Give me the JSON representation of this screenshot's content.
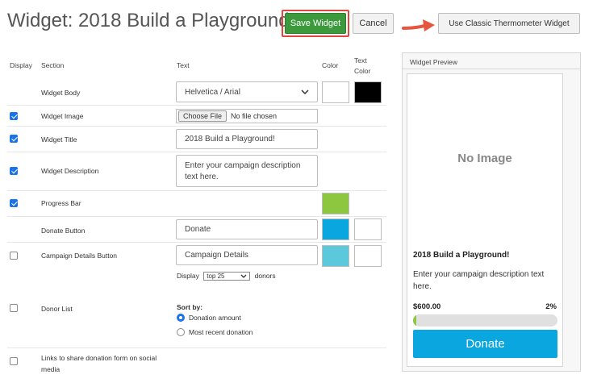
{
  "header": {
    "title": "Widget: 2018 Build a Playground!",
    "save_label": "Save Widget",
    "cancel_label": "Cancel",
    "classic_label": "Use Classic Thermometer Widget"
  },
  "columns": {
    "display": "Display",
    "section": "Section",
    "text": "Text",
    "color": "Color",
    "text_color_1": "Text",
    "text_color_2": "Color"
  },
  "rows": {
    "body": {
      "label": "Widget Body",
      "font_value": "Helvetica / Arial",
      "color": "#ffffff",
      "text_color": "#000000"
    },
    "image": {
      "label": "Widget Image",
      "checked": true,
      "file_button": "Choose File",
      "file_status": "No file chosen"
    },
    "title": {
      "label": "Widget Title",
      "checked": true,
      "value": "2018 Build a Playground!"
    },
    "description": {
      "label": "Widget Description",
      "checked": true,
      "value": "Enter your campaign description text here."
    },
    "progress": {
      "label": "Progress Bar",
      "checked": true,
      "color": "#8dc63f"
    },
    "donate": {
      "label": "Donate Button",
      "value": "Donate",
      "color": "#0aa6e0",
      "text_color": "#ffffff"
    },
    "campaign": {
      "label": "Campaign Details Button",
      "checked": false,
      "value": "Campaign Details",
      "color": "#5bc8dc",
      "text_color": "#ffffff"
    },
    "donor_display": {
      "prefix": "Display",
      "selected": "top 25",
      "suffix": "donors"
    },
    "donor_list": {
      "label": "Donor List",
      "checked": false,
      "sort_label": "Sort by:",
      "option_amount": "Donation amount",
      "option_recent": "Most recent donation",
      "selected": "amount"
    },
    "social": {
      "label_line1": "Links to share donation form on social",
      "label_line2": "media",
      "checked": false
    }
  },
  "preview": {
    "heading": "Widget Preview",
    "no_image": "No Image",
    "title": "2018 Build a Playground!",
    "description": "Enter your campaign description text here.",
    "amount": "$600.00",
    "percent": "2%",
    "progress_fraction": 0.02,
    "donate_label": "Donate"
  },
  "colors": {
    "save_green": "#3c9a3c",
    "highlight_red": "#e0483e",
    "checkbox_blue": "#1a73e8"
  }
}
